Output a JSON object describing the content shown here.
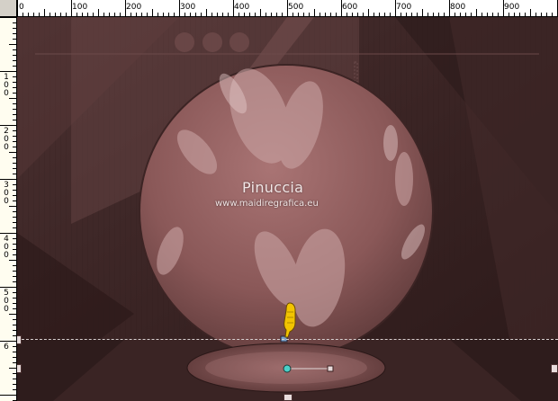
{
  "ruler": {
    "top_labels": [
      "0",
      "100",
      "200",
      "300",
      "400",
      "500",
      "600",
      "700",
      "800",
      "900"
    ],
    "left_labels": [
      "1\n0\n0",
      "2\n0\n0",
      "3\n0\n0",
      "4\n0\n0",
      "5\n0\n0",
      "6"
    ]
  },
  "watermark": {
    "title": "Pinuccia",
    "url": "www.maidiregrafica.eu"
  },
  "colors": {
    "background_dark": "#3a2626",
    "sphere": "#8a5a5a",
    "accent_pointer": "#f2c400"
  },
  "icons": {
    "pointer": "pointing-hand-icon"
  }
}
